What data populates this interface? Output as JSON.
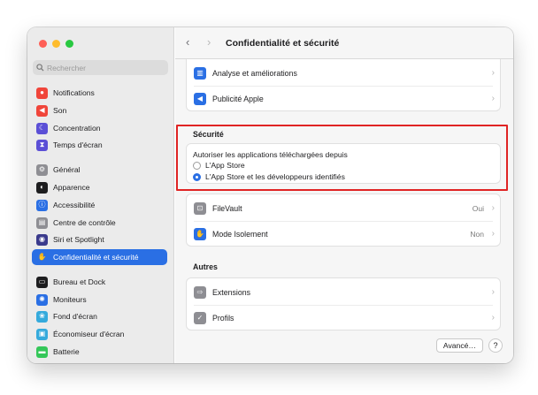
{
  "window": {
    "title": "Confidentialité et sécurité"
  },
  "colors": {
    "accent": "#2a6fe4",
    "highlight": "#e02424"
  },
  "search": {
    "placeholder": "Rechercher",
    "icon": "search-icon"
  },
  "sidebar": {
    "items": [
      {
        "label": "Notifications",
        "icon": "bell-icon",
        "color": "#f0453a"
      },
      {
        "label": "Son",
        "icon": "speaker-icon",
        "color": "#f0453a"
      },
      {
        "label": "Concentration",
        "icon": "moon-icon",
        "color": "#5b4fd6"
      },
      {
        "label": "Temps d'écran",
        "icon": "hourglass-icon",
        "color": "#5b4fd6"
      },
      {
        "label": "Général",
        "icon": "gear-icon",
        "color": "#8e8e93"
      },
      {
        "label": "Apparence",
        "icon": "appearance-icon",
        "color": "#1d1d1f"
      },
      {
        "label": "Accessibilité",
        "icon": "accessibility-icon",
        "color": "#2a6fe4"
      },
      {
        "label": "Centre de contrôle",
        "icon": "control-center-icon",
        "color": "#8e8e93"
      },
      {
        "label": "Siri et Spotlight",
        "icon": "siri-icon",
        "color": "#3a3a8c"
      },
      {
        "label": "Confidentialité et sécurité",
        "icon": "hand-icon",
        "color": "#2a6fe4"
      },
      {
        "label": "Bureau et Dock",
        "icon": "dock-icon",
        "color": "#1d1d1f"
      },
      {
        "label": "Moniteurs",
        "icon": "display-icon",
        "color": "#2a6fe4"
      },
      {
        "label": "Fond d'écran",
        "icon": "wallpaper-icon",
        "color": "#35aadc"
      },
      {
        "label": "Économiseur d'écran",
        "icon": "screensaver-icon",
        "color": "#35aadc"
      },
      {
        "label": "Batterie",
        "icon": "battery-icon",
        "color": "#34c759"
      }
    ]
  },
  "top_card": {
    "rows": [
      {
        "label": "Analyse et améliorations",
        "icon": "chart-icon",
        "color": "#2a6fe4"
      },
      {
        "label": "Publicité Apple",
        "icon": "megaphone-icon",
        "color": "#2a6fe4"
      }
    ]
  },
  "security": {
    "title": "Sécurité",
    "allow_label": "Autoriser les applications téléchargées depuis",
    "options": [
      {
        "label": "L'App Store",
        "selected": false
      },
      {
        "label": "L'App Store et les développeurs identifiés",
        "selected": true
      }
    ]
  },
  "security_rows": [
    {
      "label": "FileVault",
      "value": "Oui",
      "icon": "filevault-icon",
      "color": "#8e8e93"
    },
    {
      "label": "Mode Isolement",
      "value": "Non",
      "icon": "hand-icon",
      "color": "#2a6fe4"
    }
  ],
  "others": {
    "title": "Autres",
    "rows": [
      {
        "label": "Extensions",
        "icon": "extensions-icon",
        "color": "#8e8e93"
      },
      {
        "label": "Profils",
        "icon": "profiles-icon",
        "color": "#8e8e93"
      }
    ]
  },
  "footer": {
    "advanced_label": "Avancé…",
    "help_label": "?"
  }
}
